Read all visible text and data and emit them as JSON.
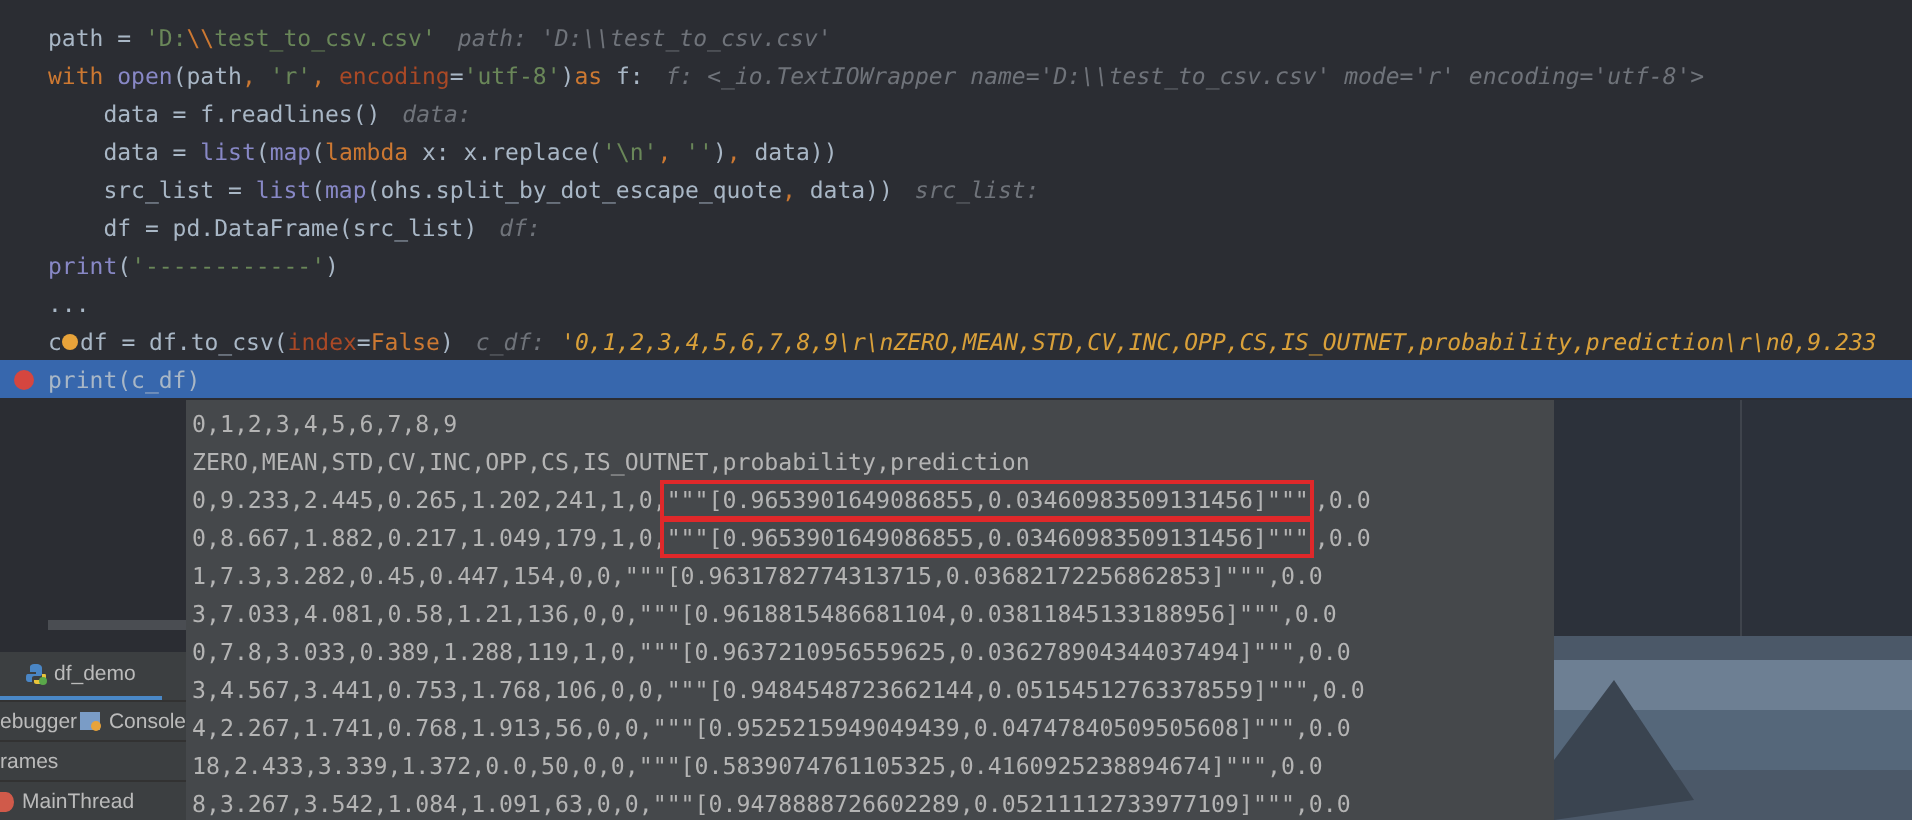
{
  "editor": {
    "lines": [
      {
        "breakpoint": false,
        "current": false,
        "tokens": [
          {
            "kind": "plain",
            "text": "path = "
          },
          {
            "kind": "string",
            "text": "'D:"
          },
          {
            "kind": "keyword",
            "text": "\\\\"
          },
          {
            "kind": "string",
            "text": "test_to_csv.csv'"
          },
          {
            "kind": "hint",
            "text": "path: 'D:\\\\test_to_csv.csv'"
          }
        ]
      },
      {
        "breakpoint": false,
        "current": false,
        "tokens": [
          {
            "kind": "keyword",
            "text": "with "
          },
          {
            "kind": "builtin",
            "text": "open"
          },
          {
            "kind": "plain",
            "text": "(path"
          },
          {
            "kind": "keyword",
            "text": ", "
          },
          {
            "kind": "string",
            "text": "'r'"
          },
          {
            "kind": "keyword",
            "text": ", "
          },
          {
            "kind": "param",
            "text": "encoding"
          },
          {
            "kind": "plain",
            "text": "="
          },
          {
            "kind": "string",
            "text": "'utf-8'"
          },
          {
            "kind": "plain",
            "text": ")"
          },
          {
            "kind": "keyword",
            "text": "as"
          },
          {
            "kind": "plain",
            "text": " f:"
          },
          {
            "kind": "hint",
            "text": "f: <_io.TextIOWrapper name='D:\\\\test_to_csv.csv' mode='r' encoding='utf-8'>"
          }
        ]
      },
      {
        "breakpoint": false,
        "current": false,
        "tokens": [
          {
            "kind": "plain",
            "text": "    data = f.readlines()"
          },
          {
            "kind": "hint",
            "text": "data:"
          }
        ]
      },
      {
        "breakpoint": false,
        "current": false,
        "tokens": [
          {
            "kind": "plain",
            "text": "    data = "
          },
          {
            "kind": "builtin",
            "text": "list"
          },
          {
            "kind": "plain",
            "text": "("
          },
          {
            "kind": "builtin",
            "text": "map"
          },
          {
            "kind": "plain",
            "text": "("
          },
          {
            "kind": "keyword",
            "text": "lambda"
          },
          {
            "kind": "plain",
            "text": " x: x.replace("
          },
          {
            "kind": "string",
            "text": "'\\n'"
          },
          {
            "kind": "keyword",
            "text": ", "
          },
          {
            "kind": "string",
            "text": "''"
          },
          {
            "kind": "plain",
            "text": ")"
          },
          {
            "kind": "keyword",
            "text": ", "
          },
          {
            "kind": "plain",
            "text": "data))"
          }
        ]
      },
      {
        "breakpoint": false,
        "current": false,
        "tokens": [
          {
            "kind": "plain",
            "text": "    src_list = "
          },
          {
            "kind": "builtin",
            "text": "list"
          },
          {
            "kind": "plain",
            "text": "("
          },
          {
            "kind": "builtin",
            "text": "map"
          },
          {
            "kind": "plain",
            "text": "(ohs.split_by_dot_escape_quote"
          },
          {
            "kind": "keyword",
            "text": ", "
          },
          {
            "kind": "plain",
            "text": "data))"
          },
          {
            "kind": "hint",
            "text": "src_list:"
          }
        ]
      },
      {
        "breakpoint": false,
        "current": false,
        "tokens": [
          {
            "kind": "plain",
            "text": "    df = pd.DataFrame(src_list)"
          },
          {
            "kind": "hint",
            "text": "df:"
          }
        ]
      },
      {
        "breakpoint": false,
        "current": false,
        "tokens": [
          {
            "kind": "builtin",
            "text": "print"
          },
          {
            "kind": "plain",
            "text": "("
          },
          {
            "kind": "string",
            "text": "'------------'"
          },
          {
            "kind": "plain",
            "text": ")"
          }
        ]
      },
      {
        "breakpoint": false,
        "current": false,
        "tokens": [
          {
            "kind": "plain",
            "text": "..."
          }
        ]
      },
      {
        "breakpoint": false,
        "current": false,
        "tokens": [
          {
            "kind": "plain",
            "text": "c"
          },
          {
            "kind": "marker"
          },
          {
            "kind": "plain",
            "text": "df = df.to_csv("
          },
          {
            "kind": "param",
            "text": "index"
          },
          {
            "kind": "plain",
            "text": "="
          },
          {
            "kind": "keyword",
            "text": "False"
          },
          {
            "kind": "plain",
            "text": ")"
          },
          {
            "kind": "hint",
            "text": "c_df:"
          },
          {
            "kind": "value",
            "text": "'0,1,2,3,4,5,6,7,8,9\\r\\nZERO,MEAN,STD,CV,INC,OPP,CS,IS_OUTNET,probability,prediction\\r\\n0,9.233"
          }
        ]
      },
      {
        "breakpoint": true,
        "current": true,
        "tokens": [
          {
            "kind": "plain",
            "text": "print(c_df)"
          }
        ]
      }
    ]
  },
  "debugger": {
    "session_tab": "df_demo",
    "tabs": [
      "ebugger",
      "Console"
    ],
    "frames_label": "rames",
    "thread": "MainThread"
  },
  "popup": {
    "rows": [
      {
        "text": "0,1,2,3,4,5,6,7,8,9"
      },
      {
        "text": "ZERO,MEAN,STD,CV,INC,OPP,CS,IS_OUTNET,probability,prediction"
      },
      {
        "text": "0,9.233,2.445,0.265,1.202,241,1,0,",
        "highlight": "\"\"\"[0.9653901649086855,0.03460983509131456]\"\"\"",
        "suffix": ",0.0"
      },
      {
        "text": "0,8.667,1.882,0.217,1.049,179,1,0,",
        "highlight": "\"\"\"[0.9653901649086855,0.03460983509131456]\"\"\"",
        "suffix": ",0.0"
      },
      {
        "text": "1,7.3,3.282,0.45,0.447,154,0,0,\"\"\"[0.9631782774313715,0.03682172256862853]\"\"\",0.0"
      },
      {
        "text": "3,7.033,4.081,0.58,1.21,136,0,0,\"\"\"[0.9618815486681104,0.03811845133188956]\"\"\",0.0"
      },
      {
        "text": "0,7.8,3.033,0.389,1.288,119,1,0,\"\"\"[0.9637210956559625,0.036278904344037494]\"\"\",0.0"
      },
      {
        "text": "3,4.567,3.441,0.753,1.768,106,0,0,\"\"\"[0.9484548723662144,0.05154512763378559]\"\"\",0.0"
      },
      {
        "text": "4,2.267,1.741,0.768,1.913,56,0,0,\"\"\"[0.9525215949049439,0.04747840509505608]\"\"\",0.0"
      },
      {
        "text": "18,2.433,3.339,1.372,0.0,50,0,0,\"\"\"[0.5839074761105325,0.4160925238894674]\"\"\",0.0"
      },
      {
        "text": "8,3.267,3.542,1.084,1.091,63,0,0,\"\"\"[0.9478888726602289,0.05211112733977109]\"\"\",0.0"
      }
    ]
  }
}
